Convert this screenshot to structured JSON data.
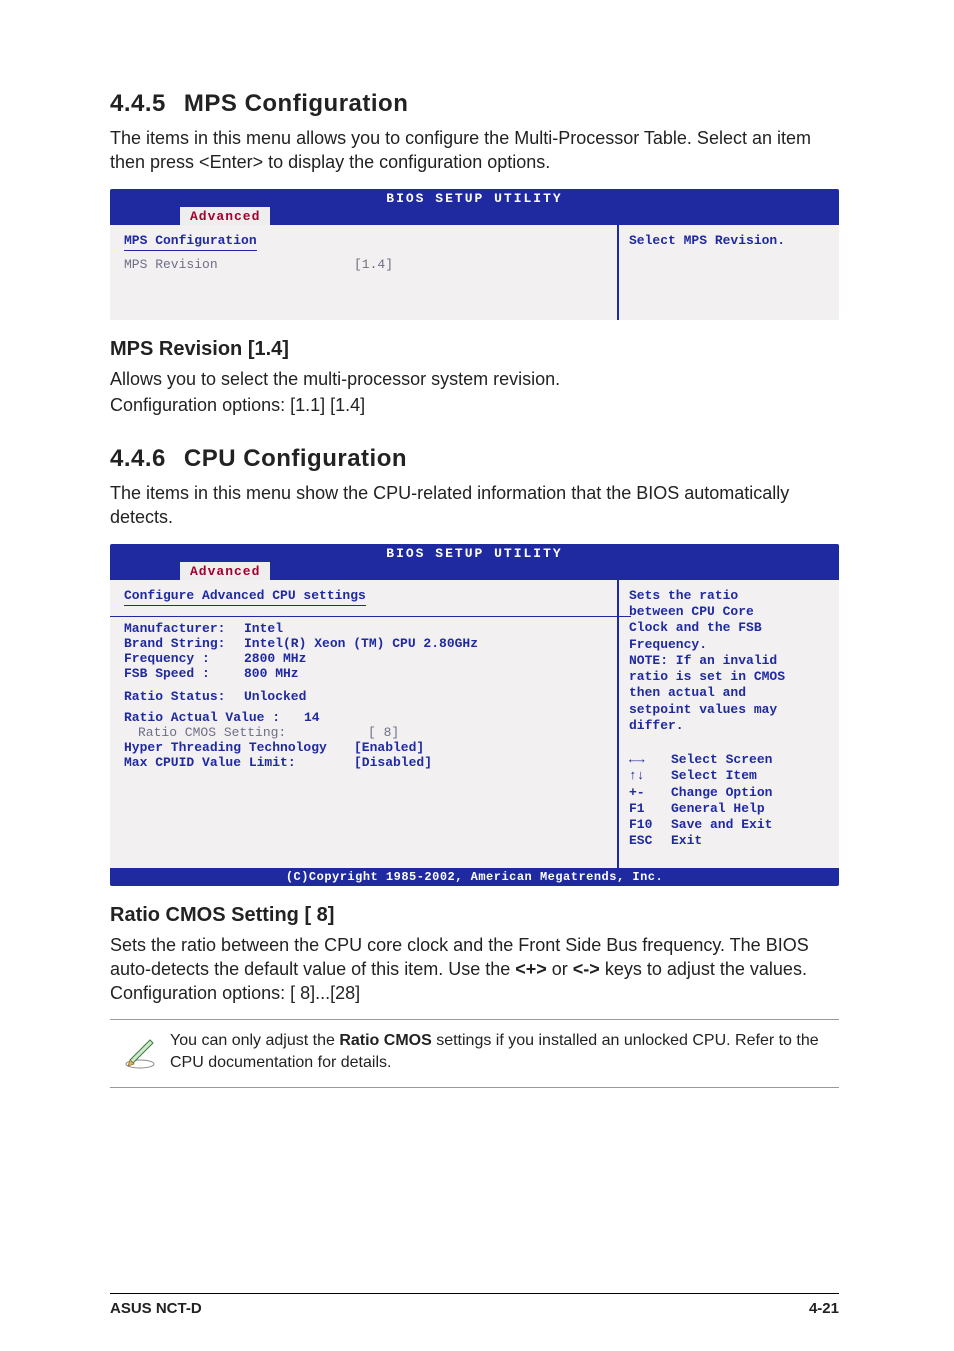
{
  "section1": {
    "number": "4.4.5",
    "title": "MPS Configuration",
    "intro": "The items in this menu allows you to configure the Multi-Processor Table. Select an item then press <Enter> to display the configuration options."
  },
  "bios1": {
    "util": "BIOS SETUP UTILITY",
    "tab": "Advanced",
    "title": "MPS Configuration",
    "row_label": "MPS Revision",
    "row_value": "[1.4]",
    "help": "Select MPS Revision."
  },
  "sub1": {
    "heading": "MPS Revision [1.4]",
    "line1": "Allows you to select the multi-processor system revision.",
    "line2": "Configuration options: [1.1] [1.4]"
  },
  "section2": {
    "number": "4.4.6",
    "title": "CPU Configuration",
    "intro": "The items in this menu show the CPU-related information that the BIOS automatically detects."
  },
  "bios2": {
    "util": "BIOS SETUP UTILITY",
    "tab": "Advanced",
    "title": "Configure Advanced CPU settings",
    "manu_label": "Manufacturer:",
    "manu_value": "Intel",
    "brand_label": "Brand String:",
    "brand_value": "Intel(R) Xeon (TM) CPU 2.80GHz",
    "freq_label": "Frequency   :",
    "freq_value": "2800 MHz",
    "fsb_label": "FSB Speed   :",
    "fsb_value": "800 MHz",
    "ratio_status_label": "Ratio Status:",
    "ratio_status_value": "Unlocked",
    "ratio_actual_label": "Ratio Actual Value :",
    "ratio_actual_value": "14",
    "ratio_cmos_label": "Ratio CMOS Setting:",
    "ratio_cmos_value": "[  8]",
    "ht_label": "Hyper Threading Technology",
    "ht_value": "[Enabled]",
    "max_cpuid_label": "Max CPUID Value Limit:",
    "max_cpuid_value": "[Disabled]",
    "help": "Sets the ratio\nbetween CPU Core\nClock and the FSB\nFrequency.\nNOTE: If an invalid\nratio is set in CMOS\nthen actual and\nsetpoint values may\ndiffer.",
    "nav": {
      "screen_k": "←→",
      "screen_v": "Select Screen",
      "item_k": "↑↓",
      "item_v": "Select Item",
      "opt_k": "+-",
      "opt_v": "Change Option",
      "help_k": "F1",
      "help_v": "General Help",
      "save_k": "F10",
      "save_v": "Save and Exit",
      "exit_k": "ESC",
      "exit_v": "Exit"
    },
    "copyright": "(C)Copyright 1985-2002, American Megatrends, Inc."
  },
  "sub2": {
    "heading": "Ratio CMOS Setting [ 8]",
    "para_part1": "Sets the ratio between the CPU core clock and the Front Side Bus frequency. The BIOS auto-detects the default value of this item. Use the ",
    "key_plus": "<+>",
    "mid": " or ",
    "key_minus": "<->",
    "para_part2": " keys to adjust the values. Configuration options: [ 8]...[28]"
  },
  "note": {
    "part1": "You can only adjust the ",
    "bold": "Ratio CMOS",
    "part2": " settings if you installed an unlocked CPU. Refer to the CPU documentation for details."
  },
  "chart_data": {
    "type": "table",
    "title": "Configure Advanced CPU settings",
    "rows": [
      {
        "label": "Manufacturer",
        "value": "Intel"
      },
      {
        "label": "Brand String",
        "value": "Intel(R) Xeon (TM) CPU 2.80GHz"
      },
      {
        "label": "Frequency",
        "value": "2800 MHz"
      },
      {
        "label": "FSB Speed",
        "value": "800 MHz"
      },
      {
        "label": "Ratio Status",
        "value": "Unlocked"
      },
      {
        "label": "Ratio Actual Value",
        "value": 14
      },
      {
        "label": "Ratio CMOS Setting",
        "value": 8
      },
      {
        "label": "Hyper Threading Technology",
        "value": "Enabled"
      },
      {
        "label": "Max CPUID Value Limit",
        "value": "Disabled"
      }
    ]
  },
  "footer": {
    "left": "ASUS NCT-D",
    "right": "4-21"
  }
}
